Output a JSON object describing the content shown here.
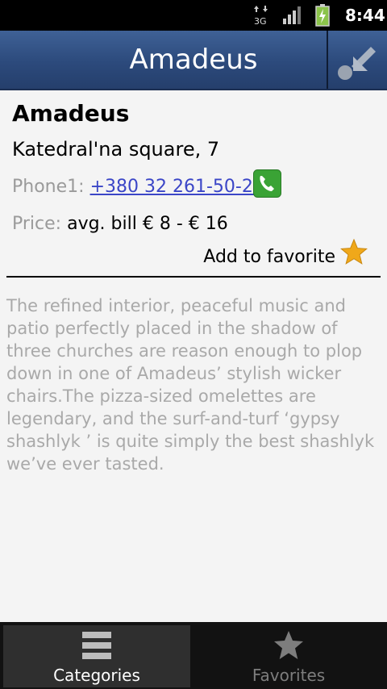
{
  "status_bar": {
    "time": "8:44",
    "icons": [
      "3g-data-icon",
      "signal-icon",
      "battery-charging-icon"
    ]
  },
  "header": {
    "title": "Amadeus",
    "back_icon": "back-arrow-icon"
  },
  "place": {
    "name": "Amadeus",
    "address": "Katedral'na square, 7",
    "phone_label": "Phone1:",
    "phone": "+380 32 261-50-22",
    "price_label": "Price:",
    "price": "avg. bill € 8 - € 16",
    "favorite_label": "Add to favorite",
    "description": "The refined interior, peaceful music and patio perfectly placed in the shadow of three churches are reason enough to plop down in one of Amadeus’ stylish wicker chairs.The pizza-sized omelettes are legendary, and the surf-and-turf ‘gypsy shashlyk ’ is quite simply the best shashlyk we’ve ever tasted."
  },
  "tabs": [
    {
      "label": "Categories",
      "icon": "categories-icon",
      "active": true
    },
    {
      "label": "Favorites",
      "icon": "star-icon",
      "active": false
    }
  ],
  "colors": {
    "header": "#2c4a7c",
    "link": "#3b46c7",
    "star": "#f0a81a",
    "call_green": "#3aa335"
  }
}
